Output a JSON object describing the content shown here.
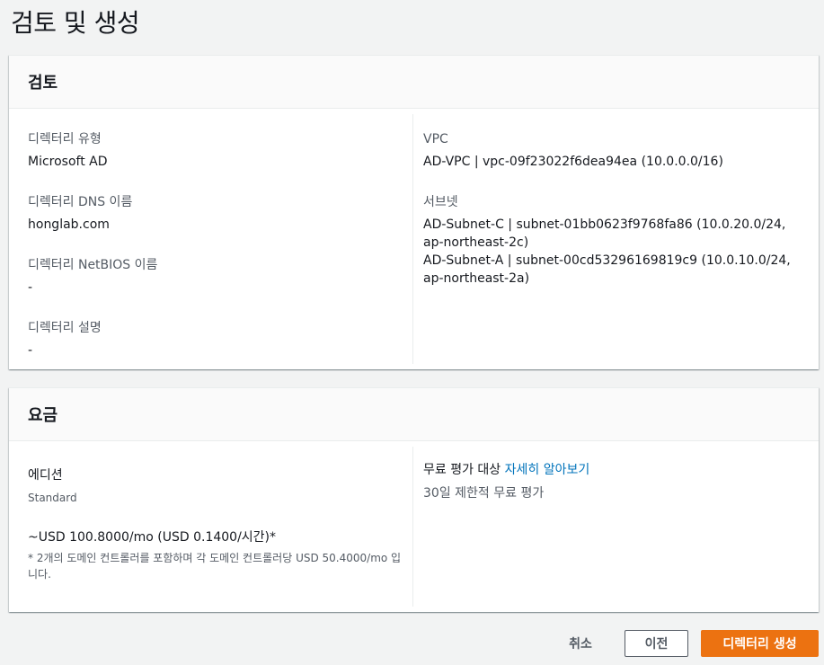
{
  "page": {
    "title": "검토 및 생성"
  },
  "review": {
    "header": "검토",
    "left": [
      {
        "label": "디렉터리 유형",
        "value": "Microsoft AD"
      },
      {
        "label": "디렉터리 DNS 이름",
        "value": "honglab.com"
      },
      {
        "label": "디렉터리 NetBIOS 이름",
        "value": "-"
      },
      {
        "label": "디렉터리 설명",
        "value": "-"
      }
    ],
    "vpc": {
      "label": "VPC",
      "value": "AD-VPC | vpc-09f23022f6dea94ea (10.0.0.0/16)"
    },
    "subnets": {
      "label": "서브넷",
      "values": [
        "AD-Subnet-C | subnet-01bb0623f9768fa86 (10.0.20.0/24, ap-northeast-2c)",
        "AD-Subnet-A | subnet-00cd53296169819c9 (10.0.10.0/24, ap-northeast-2a)"
      ]
    }
  },
  "pricing": {
    "header": "요금",
    "edition_label": "에디션",
    "edition_value": "Standard",
    "price": "~USD 100.8000/mo (USD 0.1400/시간)*",
    "footnote": "* 2개의 도메인 컨트롤러를 포함하며 각 도메인 컨트롤러당 USD 50.4000/mo 입니다.",
    "free_trial_text": "무료 평가 대상",
    "learn_more": "자세히 알아보기",
    "trial_desc": "30일 제한적 무료 평가"
  },
  "actions": {
    "cancel": "취소",
    "previous": "이전",
    "create": "디렉터리 생성"
  }
}
